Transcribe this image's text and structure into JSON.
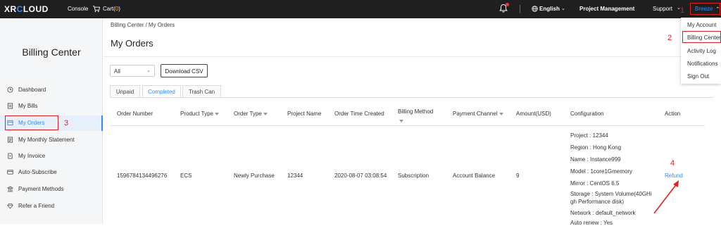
{
  "topbar": {
    "logo_pre": "XR",
    "logo_o": "C",
    "logo_post": "LOUD",
    "console": "Console",
    "cart_label": "Cart(",
    "cart_count": "0",
    "cart_close": ")",
    "language": "English",
    "project_management": "Project Management",
    "support": "Support",
    "user": "Breeze"
  },
  "breadcrumb": {
    "parent": "Billing Center",
    "sep": "/",
    "current": "My Orders"
  },
  "page_title": "My Orders",
  "filter": {
    "selected": "All"
  },
  "download_button": "Download CSV",
  "tabs": [
    "Unpaid",
    "Completed",
    "Trash Can"
  ],
  "sidebar": {
    "title": "Billing Center",
    "items": [
      {
        "label": "Dashboard",
        "icon": "clock-icon"
      },
      {
        "label": "My Bills",
        "icon": "bills-icon"
      },
      {
        "label": "My Orders",
        "icon": "orders-icon"
      },
      {
        "label": "My Monthly Statement",
        "icon": "statement-icon"
      },
      {
        "label": "My Invoice",
        "icon": "invoice-icon"
      },
      {
        "label": "Auto-Subscribe",
        "icon": "card-icon"
      },
      {
        "label": "Payment Methods",
        "icon": "bank-icon"
      },
      {
        "label": "Refer a Friend",
        "icon": "diamond-icon"
      }
    ]
  },
  "table": {
    "headers": [
      "Order Number",
      "Product Type",
      "Order Type",
      "Project Name",
      "Order Time Created",
      "Billing Method",
      "Payment Channel",
      "Amount(USD)",
      "Configuration",
      "Action"
    ],
    "row": {
      "order_number": "1596784134496276",
      "product_type": "ECS",
      "order_type": "Newly Purchase",
      "project_name": "12344",
      "order_time": "2020-08-07 03:08:54",
      "billing_method": "Subscription",
      "payment_channel": "Account Balance",
      "amount": "9",
      "configuration": [
        "Project : 12344",
        "Region : Hong Kong",
        "Name : Instance999",
        "Model : 1core1Gmemory",
        "Mirror : CentOS 6.5",
        "Storage : System Volume(40GHi",
        "gh Performance disk)",
        "Network : default_network",
        "Auto renew : Yes"
      ],
      "action": "Refund"
    }
  },
  "user_menu": [
    "My Account",
    "Billing Center",
    "Activity Log",
    "Notifications",
    "Sign Out"
  ],
  "annotations": [
    "1",
    "2",
    "3",
    "4"
  ],
  "colors": {
    "accent": "#2f8cff",
    "highlight": "#e02020",
    "topbar": "#1f1f1f"
  }
}
